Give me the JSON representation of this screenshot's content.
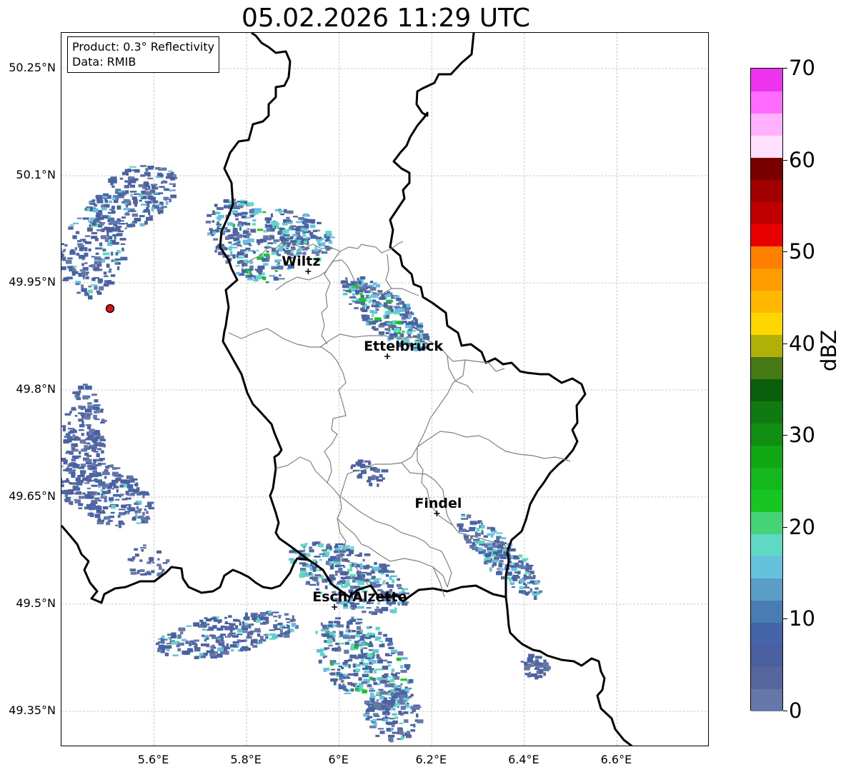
{
  "title": "05.02.2026 11:29 UTC",
  "info": {
    "product_line": "Product: 0.3° Reflectivity",
    "data_line": "Data: RMIB"
  },
  "map": {
    "lon_range": [
      5.4,
      6.8
    ],
    "lat_range": [
      49.3,
      50.3
    ],
    "lat_ticks": [
      "50.25°N",
      "50.1°N",
      "49.95°N",
      "49.8°N",
      "49.65°N",
      "49.5°N",
      "49.35°N"
    ],
    "lon_ticks": [
      "5.6°E",
      "5.8°E",
      "6°E",
      "6.2°E",
      "6.4°E",
      "6.6°E"
    ],
    "radar_site": {
      "lon": 5.505,
      "lat": 49.914,
      "color": "#e01010"
    },
    "cities": [
      {
        "name": "Wiltz",
        "lon": 5.933,
        "lat": 49.966
      },
      {
        "name": "Ettelbruck",
        "lon": 6.104,
        "lat": 49.847
      },
      {
        "name": "Findel",
        "lon": 6.211,
        "lat": 49.627
      },
      {
        "name": "Esch/Alzette",
        "lon": 5.99,
        "lat": 49.496
      }
    ]
  },
  "colorbar": {
    "label": "dBZ",
    "min": 0,
    "max": 70,
    "ticks": [
      "0",
      "10",
      "20",
      "30",
      "40",
      "50",
      "60",
      "70"
    ],
    "colors": [
      "#6677aa",
      "#55669f",
      "#4a5fa0",
      "#4466a8",
      "#4a7cb4",
      "#5a9ec7",
      "#66c2dc",
      "#5fd8c4",
      "#44d377",
      "#17c622",
      "#14b81c",
      "#11a816",
      "#108f12",
      "#0f7a11",
      "#0b5f0c",
      "#467814",
      "#b0b008",
      "#ffd700",
      "#ffb700",
      "#ff9c00",
      "#ff7f00",
      "#e80000",
      "#c00000",
      "#a00000",
      "#7a0000",
      "#ffe0ff",
      "#ffb0ff",
      "#ff6cff",
      "#ee33ee"
    ]
  }
}
